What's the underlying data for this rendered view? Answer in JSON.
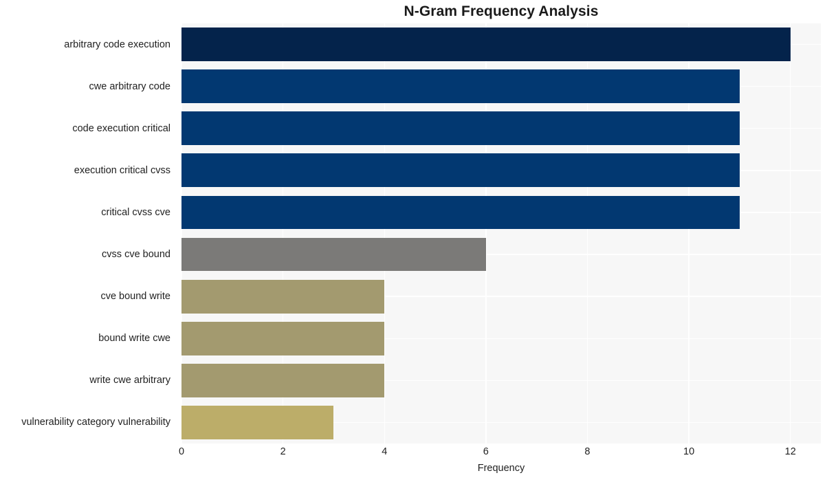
{
  "chart_data": {
    "type": "bar",
    "orientation": "horizontal",
    "title": "N-Gram Frequency Analysis",
    "xlabel": "Frequency",
    "ylabel": "",
    "xlim": [
      0,
      12.6
    ],
    "xticks": [
      0,
      2,
      4,
      6,
      8,
      10,
      12
    ],
    "xticklabels": [
      "0",
      "2",
      "4",
      "6",
      "8",
      "10",
      "12"
    ],
    "grid": true,
    "legend": null,
    "categories": [
      "arbitrary code execution",
      "cwe arbitrary code",
      "code execution critical",
      "execution critical cvss",
      "critical cvss cve",
      "cvss cve bound",
      "cve bound write",
      "bound write cwe",
      "write cwe arbitrary",
      "vulnerability category vulnerability"
    ],
    "values": [
      12,
      11,
      11,
      11,
      11,
      6,
      4,
      4,
      4,
      3
    ],
    "bar_colors": [
      "#04234b",
      "#023871",
      "#023871",
      "#023871",
      "#023871",
      "#7b7a78",
      "#a39a6f",
      "#a39a6f",
      "#a39a6f",
      "#bcad69"
    ],
    "plot_background": "#f7f7f7",
    "grid_color": "#ffffff",
    "figure_background": "#ffffff",
    "text_color": "#1f1f1f"
  }
}
